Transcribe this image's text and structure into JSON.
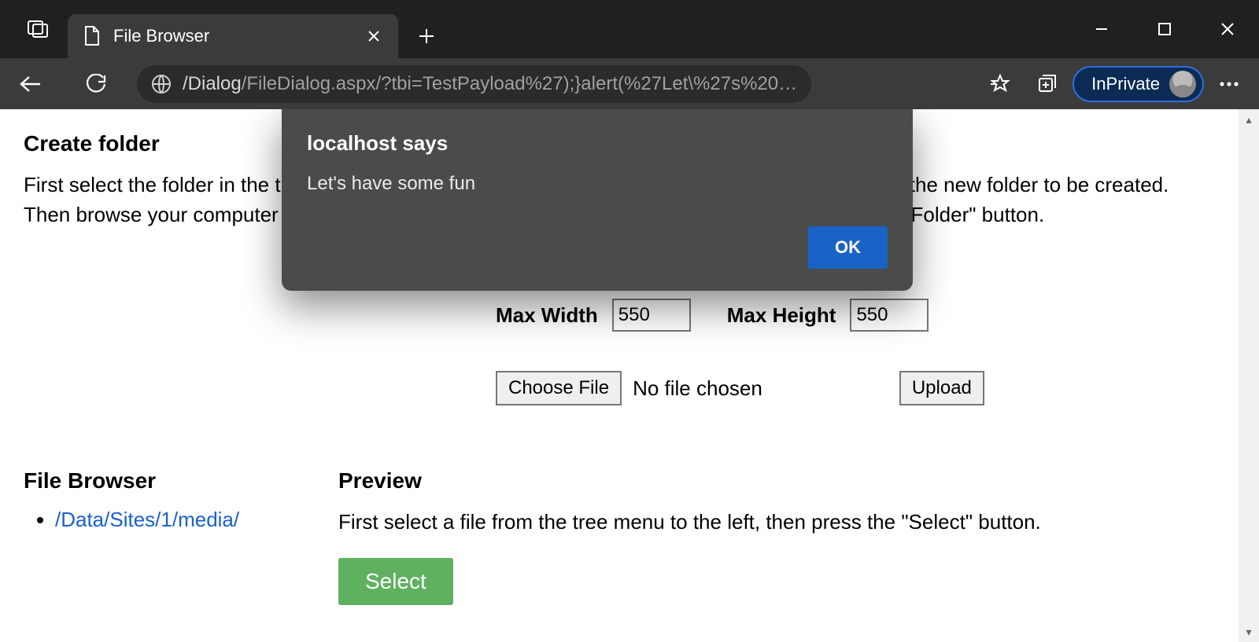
{
  "browser": {
    "tab_title": "File Browser",
    "url_display_primary": "/Dialog",
    "url_display_secondary": "/FileDialog.aspx/?tbi=TestPayload%27);}alert(%27Let\\%27s%20…",
    "inprivate_label": "InPrivate"
  },
  "alert": {
    "title": "localhost says",
    "message": "Let's have some fun",
    "ok_label": "OK"
  },
  "page": {
    "create_folder": {
      "heading": "Create folder",
      "text": "First select the folder in the tree menu to the left, in which you would like the new file to would like the new folder to be created. Then browse your computer and press the \"Upload\" give the folder a name and press the \"Create Folder\" button."
    },
    "upload": {
      "obscured_row": "",
      "max_width_label": "Max Width",
      "max_width_value": "550",
      "max_height_label": "Max Height",
      "max_height_value": "550",
      "choose_file_label": "Choose File",
      "file_status": "No file chosen",
      "upload_label": "Upload"
    },
    "file_browser": {
      "heading": "File Browser",
      "tree_link": "/Data/Sites/1/media/"
    },
    "preview": {
      "heading": "Preview",
      "text": "First select a file from the tree menu to the left, then press the \"Select\" button.",
      "select_label": "Select"
    }
  }
}
